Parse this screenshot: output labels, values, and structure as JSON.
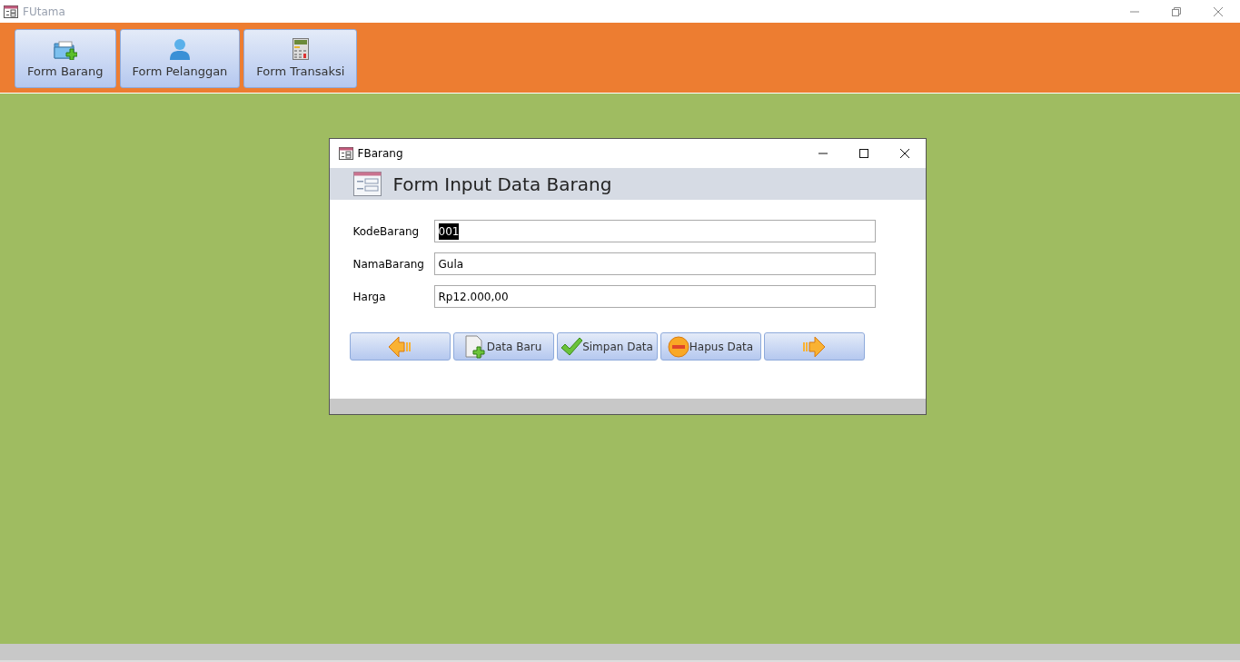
{
  "window": {
    "title": "FUtama"
  },
  "toolbar": [
    {
      "label": "Form Barang",
      "kind": "folder"
    },
    {
      "label": "Form Pelanggan",
      "kind": "person"
    },
    {
      "label": "Form Transaksi",
      "kind": "calculator"
    }
  ],
  "dialog": {
    "title": "FBarang",
    "header": "Form Input Data Barang",
    "fields": [
      {
        "label": "KodeBarang",
        "value": "001",
        "selected": true
      },
      {
        "label": "NamaBarang",
        "value": "Gula",
        "selected": false
      },
      {
        "label": "Harga",
        "value": "Rp12.000,00",
        "selected": false
      }
    ],
    "buttons": [
      {
        "kind": "previous"
      },
      {
        "kind": "new",
        "label": "Data Baru"
      },
      {
        "kind": "save",
        "label": "Simpan Data"
      },
      {
        "kind": "delete",
        "label": "Hapus Data"
      },
      {
        "kind": "next"
      }
    ]
  }
}
